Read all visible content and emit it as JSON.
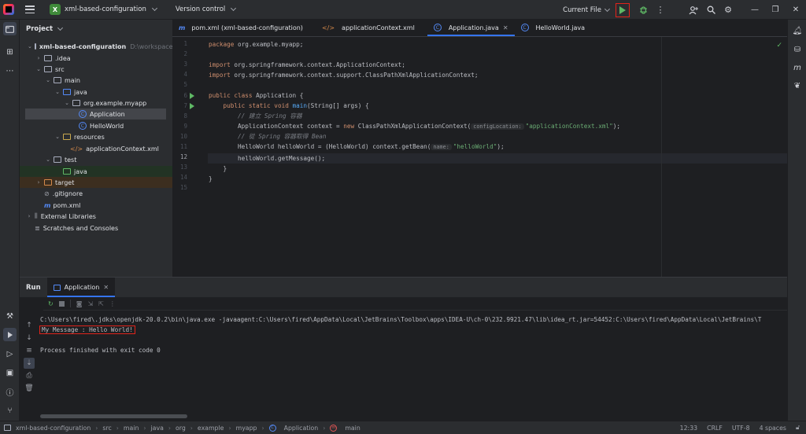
{
  "titlebar": {
    "project_badge": "X",
    "project_name": "xml-based-configuration",
    "vcs_label": "Version control",
    "run_config": "Current File"
  },
  "project_panel": {
    "title": "Project",
    "tree": [
      {
        "label": "xml-based-configuration",
        "hint": "D:\\workspace\\S"
      },
      {
        "label": ".idea"
      },
      {
        "label": "src"
      },
      {
        "label": "main"
      },
      {
        "label": "java"
      },
      {
        "label": "org.example.myapp"
      },
      {
        "label": "Application"
      },
      {
        "label": "HelloWorld"
      },
      {
        "label": "resources"
      },
      {
        "label": "applicationContext.xml"
      },
      {
        "label": "test"
      },
      {
        "label": "java"
      },
      {
        "label": "target"
      },
      {
        "label": ".gitignore"
      },
      {
        "label": "pom.xml"
      },
      {
        "label": "External Libraries"
      },
      {
        "label": "Scratches and Consoles"
      }
    ]
  },
  "editor": {
    "tabs": [
      {
        "label": "pom.xml (xml-based-configuration)"
      },
      {
        "label": "applicationContext.xml"
      },
      {
        "label": "Application.java"
      },
      {
        "label": "HelloWorld.java"
      }
    ],
    "line_numbers": [
      "1",
      "2",
      "3",
      "4",
      "5",
      "6",
      "7",
      "8",
      "9",
      "10",
      "11",
      "12",
      "13",
      "14",
      "15"
    ],
    "code": {
      "l1_kw": "package",
      "l1_rest": " org.example.myapp;",
      "l3_kw": "import",
      "l3_rest": " org.springframework.context.ApplicationContext;",
      "l4_kw": "import",
      "l4_rest": " org.springframework.context.support.ClassPathXmlApplicationContext;",
      "l6_kw": "public class",
      "l6_rest": " Application {",
      "l7_indent": "    ",
      "l7_kw": "public static void",
      "l7_fn": " main",
      "l7_rest": "(String[] args) {",
      "l8": "        // 建立 Spring 容器",
      "l9_a": "        ApplicationContext context = ",
      "l9_kw": "new",
      "l9_b": " ClassPathXmlApplicationContext(",
      "l9_hint": "configLocation:",
      "l9_str": "\"applicationContext.xml\"",
      "l9_c": ");",
      "l10": "        // 從 Spring 容器取得 Bean",
      "l11_a": "        HelloWorld helloWorld = (HelloWorld) context.getBean(",
      "l11_hint": "name:",
      "l11_str": "\"helloWorld\"",
      "l11_c": ");",
      "l12": "        helloWorld.getMessage();",
      "l13": "    }",
      "l14": "}"
    }
  },
  "run_panel": {
    "title": "Run",
    "tab_label": "Application",
    "console": {
      "cmd": "C:\\Users\\fired\\.jdks\\openjdk-20.0.2\\bin\\java.exe -javaagent:C:\\Users\\fired\\AppData\\Local\\JetBrains\\Toolbox\\apps\\IDEA-U\\ch-0\\232.9921.47\\lib\\idea_rt.jar=54452:C:\\Users\\fired\\AppData\\Local\\JetBrains\\T",
      "output": "My Message : Hello World!",
      "exit": "Process finished with exit code 0"
    }
  },
  "statusbar": {
    "crumbs": [
      "xml-based-configuration",
      "src",
      "main",
      "java",
      "org",
      "example",
      "myapp",
      "Application",
      "main"
    ],
    "position": "12:33",
    "line_sep": "CRLF",
    "encoding": "UTF-8",
    "indent": "4 spaces"
  },
  "colors": {
    "accent": "#3574f0",
    "highlight_box": "#e2231a",
    "run_green": "#5fb865"
  }
}
